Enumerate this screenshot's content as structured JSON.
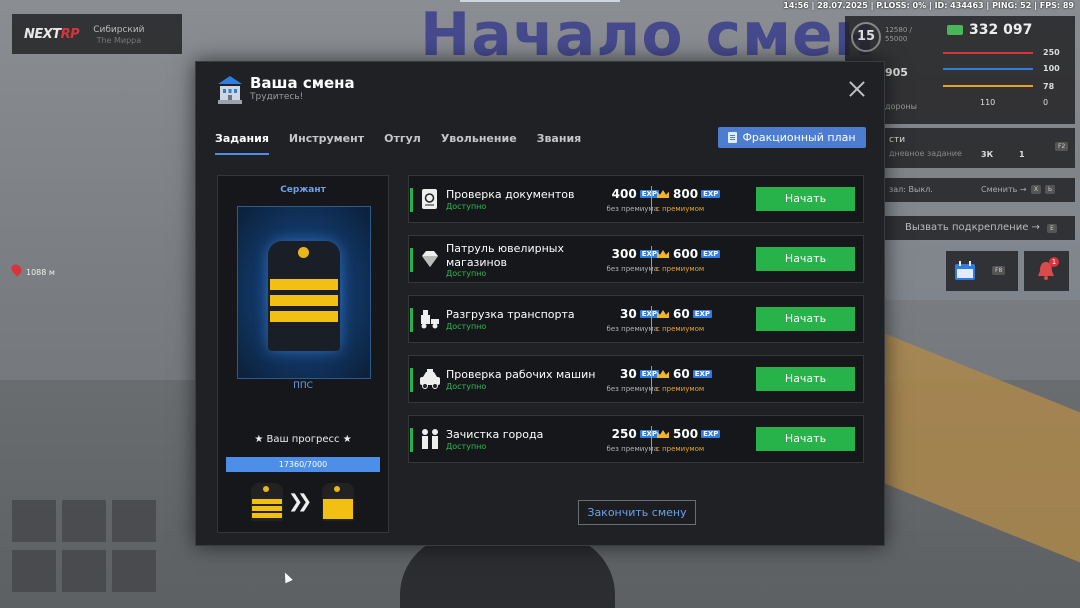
{
  "hud": {
    "top_info": "14:56 | 28.07.2025 | P.LOSS: 0% | ID: 434463 | PING: 52 | FPS: 89",
    "background_sign": "Начало смен",
    "server_logo_a": "NEXT",
    "server_logo_b": "RP",
    "server_name": "Сибирский",
    "server_sub": "The Мирра",
    "level": "15",
    "xp_line1": "12580 /",
    "xp_line2": "55000",
    "money": "332 097",
    "stats": [
      {
        "value": "250",
        "color": "#d8343b"
      },
      {
        "value": "100",
        "color": "#2f7de0"
      },
      {
        "value": "78",
        "color": "#e7a32b"
      },
      {
        "value": "0",
        "color": "#888888"
      }
    ],
    "hud_905": "905",
    "hud_110": "110",
    "hud_side_text": "дороны",
    "task_title": "сти",
    "task_sub": "дневное задание",
    "task_reward1": "3К",
    "task_reward2": "1",
    "task_key": "F2",
    "radio_text": "зал: Выкл.",
    "radio_switch": "Сменить →",
    "radio_key1": "X",
    "radio_key2": "Ь",
    "backup_text": "Вызвать подкрепление →",
    "backup_key": "E",
    "cal_key": "F8",
    "bell_badge": "1",
    "gps_distance": "1088 м"
  },
  "modal": {
    "title": "Ваша смена",
    "subtitle": "Трудитесь!",
    "tabs": [
      {
        "label": "Задания",
        "active": true
      },
      {
        "label": "Инструмент",
        "active": false
      },
      {
        "label": "Отгул",
        "active": false
      },
      {
        "label": "Увольнение",
        "active": false
      },
      {
        "label": "Звания",
        "active": false
      }
    ],
    "plan_button": "Фракционный план",
    "rank": {
      "name": "Сержант",
      "division": "ППС",
      "progress_label": "★ Ваш прогресс ★",
      "progress_text": "17360/7000",
      "progress_fraction": 1.0
    },
    "exp_tag": "EXP",
    "base_label": "без премиума",
    "prem_label": "с премиумом",
    "start_label": "Начать",
    "status_label": "Доступно",
    "tasks": [
      {
        "name": "Проверка документов",
        "base": "400",
        "prem": "800",
        "icon": "passport-icon"
      },
      {
        "name": "Патруль ювелирных магазинов",
        "base": "300",
        "prem": "600",
        "icon": "diamond-icon"
      },
      {
        "name": "Разгрузка транспорта",
        "base": "30",
        "prem": "60",
        "icon": "forklift-icon"
      },
      {
        "name": "Проверка рабочих машин",
        "base": "30",
        "prem": "60",
        "icon": "taxi-icon"
      },
      {
        "name": "Зачистка города",
        "base": "250",
        "prem": "500",
        "icon": "workers-icon"
      }
    ],
    "end_button": "Закончить смену"
  }
}
